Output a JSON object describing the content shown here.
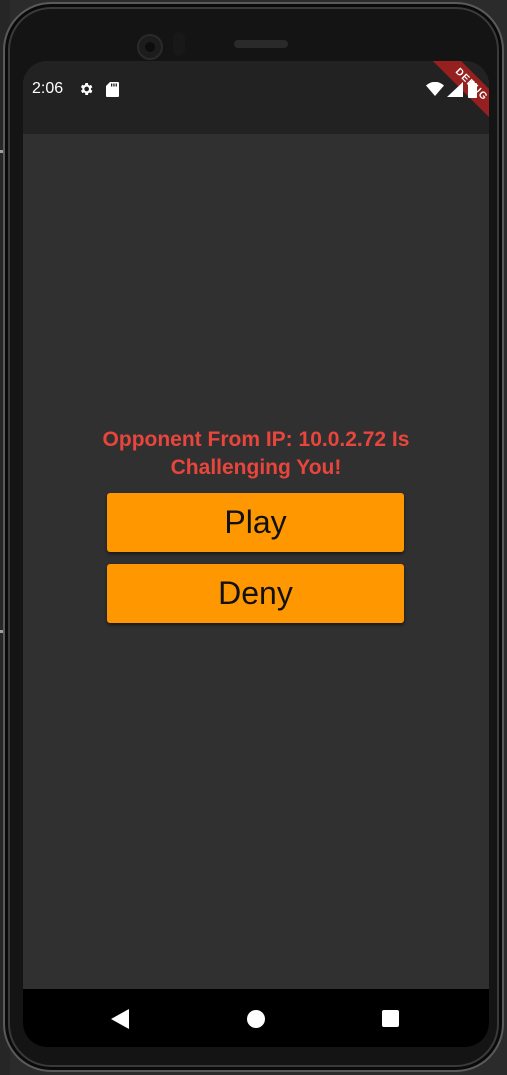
{
  "status_bar": {
    "time": "2:06",
    "icons": [
      "gear-icon",
      "sd-card-icon",
      "wifi-icon",
      "signal-icon",
      "battery-icon"
    ]
  },
  "debug_banner": "DEBUG",
  "challenge": {
    "message": "Opponent From IP: 10.0.2.72 Is Challenging You!",
    "play_label": "Play",
    "deny_label": "Deny"
  },
  "nav_bar": {
    "icons": [
      "back-icon",
      "home-icon",
      "recents-icon"
    ]
  },
  "colors": {
    "accent_button": "#ff9800",
    "message_text": "#e8453c",
    "background": "#303030",
    "status_bar": "#222222"
  }
}
